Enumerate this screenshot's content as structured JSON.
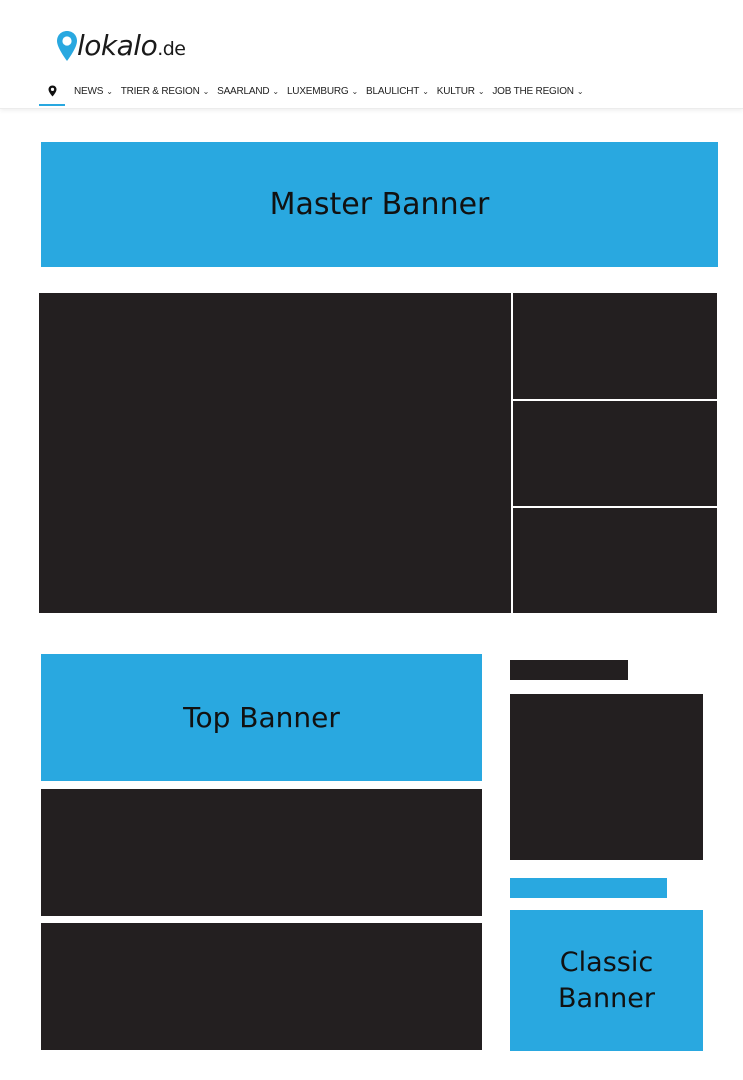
{
  "header": {
    "logo": {
      "name": "lokalo",
      "tld": ".de"
    },
    "nav": {
      "home_icon": "map-pin-icon",
      "items": [
        {
          "label": "NEWS",
          "has_dropdown": true
        },
        {
          "label": "TRIER & REGION",
          "has_dropdown": true
        },
        {
          "label": "SAARLAND",
          "has_dropdown": true
        },
        {
          "label": "LUXEMBURG",
          "has_dropdown": true
        },
        {
          "label": "BLAULICHT",
          "has_dropdown": true
        },
        {
          "label": "KULTUR",
          "has_dropdown": true
        },
        {
          "label": "JOB THE REGION",
          "has_dropdown": true
        }
      ],
      "chevron_glyph": "⌄"
    }
  },
  "banners": {
    "master": "Master Banner",
    "top": "Top Banner",
    "classic": "Classic Banner"
  },
  "colors": {
    "accent": "#29a8e0",
    "placeholder": "#231f20",
    "text": "#111111"
  }
}
